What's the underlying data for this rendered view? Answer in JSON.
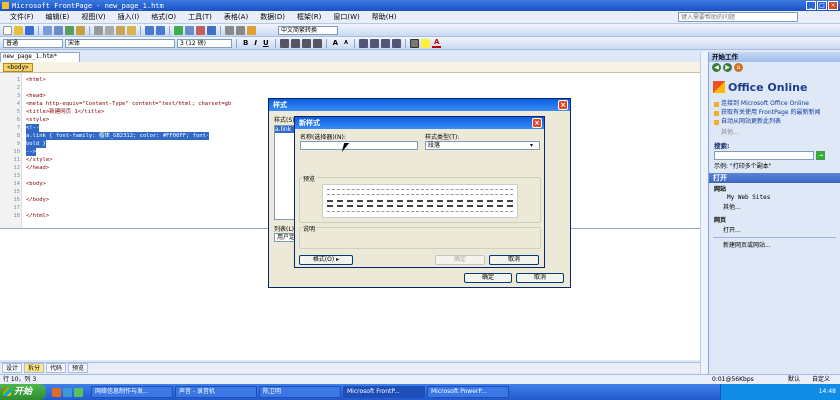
{
  "app": {
    "title": "Microsoft FrontPage - new_page_1.htm",
    "help_placeholder": "键入需要帮助的问题"
  },
  "menu": [
    "文件(F)",
    "编辑(E)",
    "视图(V)",
    "插入(I)",
    "格式(O)",
    "工具(T)",
    "表格(A)",
    "数据(D)",
    "框架(R)",
    "窗口(W)",
    "帮助(H)"
  ],
  "toolbar": {
    "style": "普通",
    "font": "宋体",
    "size": "3 (12 磅)",
    "ime": "中文简繁转换"
  },
  "editor": {
    "doc_tab": "new_page_1.htm*",
    "tag": "<body>",
    "lines": [
      {
        "n": "1",
        "text": "<html>",
        "cls": ""
      },
      {
        "n": "2",
        "text": "",
        "cls": ""
      },
      {
        "n": "3",
        "text": "<head>",
        "cls": ""
      },
      {
        "n": "4",
        "text": "<meta http-equiv=\"Content-Type\" content=\"text/html; charset=gb",
        "cls": ""
      },
      {
        "n": "5",
        "text": "<title>新建网页 1</title>",
        "cls": ""
      },
      {
        "n": "6",
        "text": "<style>",
        "cls": ""
      },
      {
        "n": "7",
        "text": "<!--",
        "cls": "sel"
      },
      {
        "n": "8",
        "text": "a.link      { font-family: 楷体_GB2312; color: #FF00FF; font-",
        "cls": "sel"
      },
      {
        "n": "9",
        "text": "              bold }",
        "cls": "sel"
      },
      {
        "n": "10",
        "text": "-->",
        "cls": "sel"
      },
      {
        "n": "11",
        "text": "</style>",
        "cls": ""
      },
      {
        "n": "12",
        "text": "</head>",
        "cls": ""
      },
      {
        "n": "13",
        "text": "",
        "cls": ""
      },
      {
        "n": "14",
        "text": "<body>",
        "cls": ""
      },
      {
        "n": "15",
        "text": "",
        "cls": ""
      },
      {
        "n": "16",
        "text": "</body>",
        "cls": ""
      },
      {
        "n": "17",
        "text": "",
        "cls": ""
      },
      {
        "n": "18",
        "text": "</html>",
        "cls": ""
      }
    ]
  },
  "view_tabs": [
    "设计",
    "拆分",
    "代码",
    "预览"
  ],
  "status": {
    "pos": "行 10，列 3",
    "speed": "0:01@56Kbps",
    "mode1": "默认",
    "mode2": "自定义"
  },
  "taskpane": {
    "title": "开始工作",
    "office_online": "Office Online",
    "links": [
      "连接到 Microsoft Office Online",
      "获取有关使用 FrontPage 的最新新闻",
      "自动从网站更新此列表"
    ],
    "more": "其他...",
    "search_label": "搜索:",
    "example": "示例: \"打印多个副本\"",
    "open_section": "打开",
    "site_label": "网站",
    "site_item": "My Web Sites",
    "site_more": "其他...",
    "page_label": "网页",
    "page_open": "打开...",
    "new_site": "新建网页或网站..."
  },
  "style_dialog": {
    "title": "样式",
    "styles_label": "样式(S):",
    "style_item": "a.link",
    "list_label": "列表(L):",
    "list_value": "用户定"
  },
  "new_style_dialog": {
    "title": "新样式",
    "name_label": "名称(选择器)(N):",
    "name_value": "",
    "type_label": "样式类型(T):",
    "type_value": "段落",
    "preview_label": "预览",
    "desc_label": "说明",
    "format_button": "格式(O)",
    "ok_disabled": "确定",
    "cancel_inner": "取消",
    "ok": "确定",
    "cancel": "取消"
  },
  "taskbar": {
    "start": "开始",
    "items": [
      "网络信息制作与发...",
      "声音 - 录音机",
      "陈卫明",
      "Microsoft FrontP...",
      "Microsoft PowerP..."
    ],
    "time": "14:48"
  }
}
